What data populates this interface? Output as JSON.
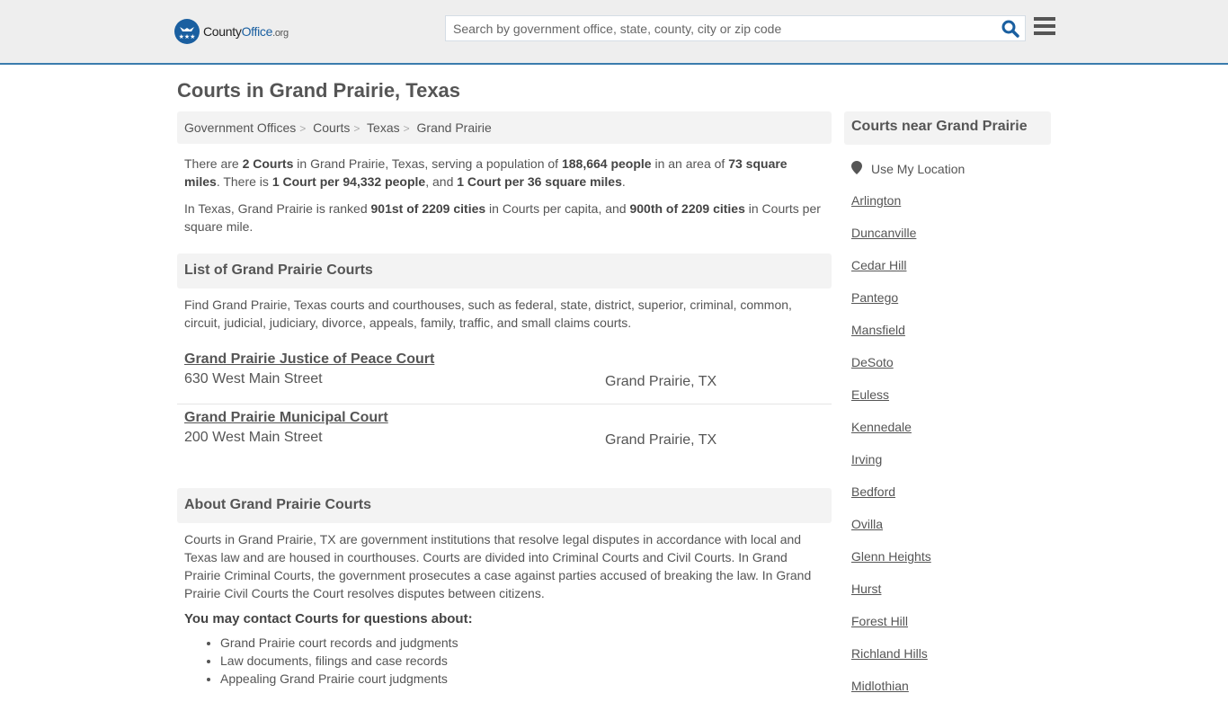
{
  "header": {
    "logo": {
      "name_part1": "County",
      "name_part2": "Office",
      "tld": ".org"
    },
    "search": {
      "placeholder": "Search by government office, state, county, city or zip code",
      "value": ""
    },
    "colors": {
      "brand": "#1a5fa0",
      "accent_border": "#3a7cad"
    }
  },
  "page": {
    "title": "Courts in Grand Prairie, Texas",
    "breadcrumb": [
      "Government Offices",
      "Courts",
      "Texas",
      "Grand Prairie"
    ],
    "summary": {
      "p1": {
        "t1": "There are ",
        "b1": "2 Courts",
        "t2": " in Grand Prairie, Texas, serving a population of ",
        "b2": "188,664 people",
        "t3": " in an area of ",
        "b3": "73 square miles",
        "t4": ". There is ",
        "b4": "1 Court per 94,332 people",
        "t5": ", and ",
        "b5": "1 Court per 36 square miles",
        "t6": "."
      },
      "p2": {
        "t1": "In Texas, Grand Prairie is ranked ",
        "b1": "901st of 2209 cities",
        "t2": " in Courts per capita, and ",
        "b2": "900th of 2209 cities",
        "t3": " in Courts per square mile."
      }
    },
    "list_section": {
      "heading": "List of Grand Prairie Courts",
      "intro": "Find Grand Prairie, Texas courts and courthouses, such as federal, state, district, superior, criminal, common, circuit, judicial, judiciary, divorce, appeals, family, traffic, and small claims courts.",
      "courts": [
        {
          "name": "Grand Prairie Justice of Peace Court",
          "address": "630 West Main Street",
          "city": "Grand Prairie, TX"
        },
        {
          "name": "Grand Prairie Municipal Court",
          "address": "200 West Main Street",
          "city": "Grand Prairie, TX"
        }
      ]
    },
    "about_section": {
      "heading": "About Grand Prairie Courts",
      "body": "Courts in Grand Prairie, TX are government institutions that resolve legal disputes in accordance with local and Texas law and are housed in courthouses. Courts are divided into Criminal Courts and Civil Courts. In Grand Prairie Criminal Courts, the government prosecutes a case against parties accused of breaking the law. In Grand Prairie Civil Courts the Court resolves disputes between citizens.",
      "contact_heading": "You may contact Courts for questions about:",
      "contact_items": [
        "Grand Prairie court records and judgments",
        "Law documents, filings and case records",
        "Appealing Grand Prairie court judgments"
      ]
    }
  },
  "sidebar": {
    "heading": "Courts near Grand Prairie",
    "use_location": "Use My Location",
    "cities": [
      "Arlington",
      "Duncanville",
      "Cedar Hill",
      "Pantego",
      "Mansfield",
      "DeSoto",
      "Euless",
      "Kennedale",
      "Irving",
      "Bedford",
      "Ovilla",
      "Glenn Heights",
      "Hurst",
      "Forest Hill",
      "Richland Hills",
      "Midlothian"
    ]
  }
}
